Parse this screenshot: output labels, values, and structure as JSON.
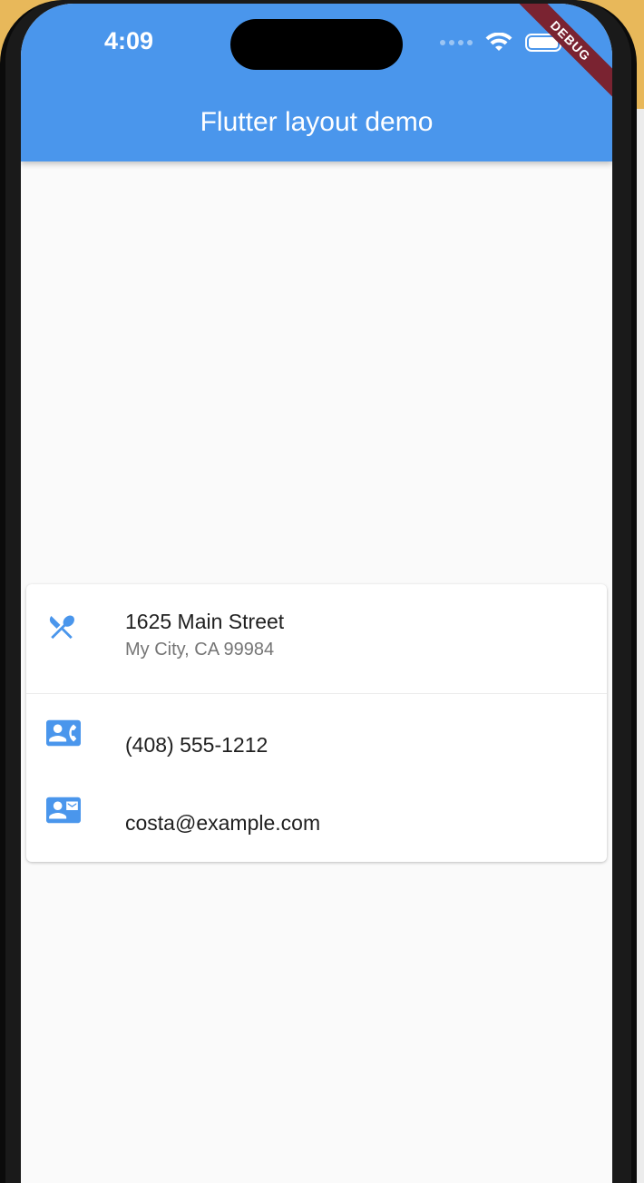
{
  "status_bar": {
    "time": "4:09",
    "battery_level": 1.0
  },
  "debug_banner": "DEBUG",
  "app_bar": {
    "title": "Flutter layout demo",
    "color": "#4a96ec"
  },
  "card": {
    "address": {
      "icon": "restaurant-icon",
      "title": "1625 Main Street",
      "subtitle": "My City, CA 99984"
    },
    "phone": {
      "icon": "contact-phone-icon",
      "title": "(408) 555-1212"
    },
    "email": {
      "icon": "contact-mail-icon",
      "title": "costa@example.com"
    }
  },
  "colors": {
    "accent": "#4a96ec",
    "background": "#fafafa",
    "card": "#ffffff"
  }
}
